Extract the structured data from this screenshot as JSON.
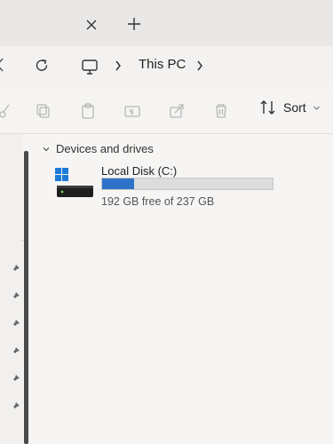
{
  "window": {
    "tab_close_icon": "close-icon",
    "new_tab_icon": "plus-icon"
  },
  "addressbar": {
    "refresh_icon": "refresh-icon",
    "location_icon": "monitor-icon",
    "breadcrumb": [
      "This PC"
    ]
  },
  "toolbar": {
    "icons": [
      "cut-icon",
      "copy-icon",
      "paste-icon",
      "rename-icon",
      "share-icon",
      "delete-icon"
    ],
    "sort_label": "Sort"
  },
  "sections": {
    "devices": {
      "title": "Devices and drives",
      "drives": [
        {
          "name": "Local Disk (C:)",
          "free_text": "192 GB free of 237 GB",
          "used_fraction": 0.19,
          "bar_color": "#2f73c9"
        }
      ]
    }
  },
  "sidebar": {
    "pinned_icon": "pin-icon",
    "pinned_count": 6
  },
  "colors": {
    "accent": "#2f73c9",
    "window_bg": "#f6f5f3",
    "titlebar_bg": "#e9e8e6"
  }
}
